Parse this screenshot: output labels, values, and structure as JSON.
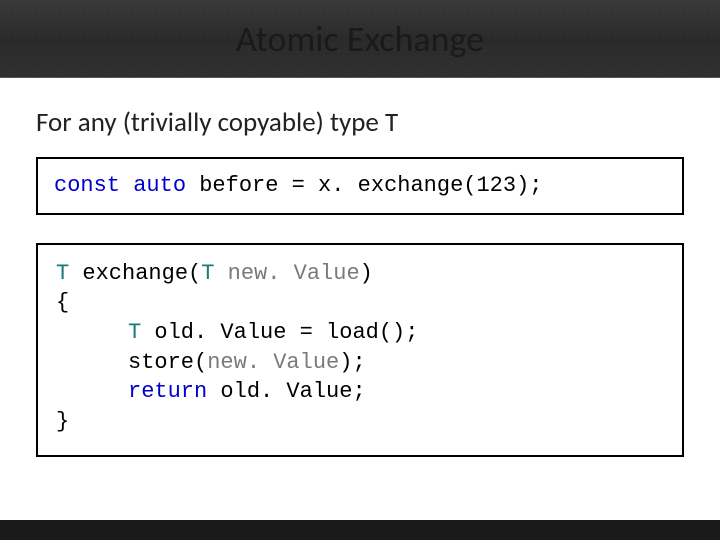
{
  "slide": {
    "title": "Atomic Exchange",
    "intro": "For any (trivially copyable) type T"
  },
  "code1": {
    "kw_const": "const",
    "kw_auto": "auto",
    "rest": " before = x. exchange(123);"
  },
  "code2": {
    "line1_type1": "T",
    "line1_func": " exchange(",
    "line1_type2": "T",
    "line1_param": " new. Value",
    "line1_close": ")",
    "line2": "{",
    "line3_type": "T",
    "line3_rest": " old. Value = load();",
    "line4_a": "store(",
    "line4_b": "new. Value",
    "line4_c": ");",
    "line5_kw": "return",
    "line5_rest": " old. Value;",
    "line6": "}"
  }
}
